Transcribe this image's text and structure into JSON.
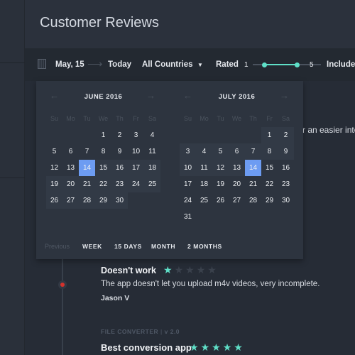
{
  "header": {
    "title": "Customer Reviews"
  },
  "filter": {
    "from": "May, 15",
    "to": "Today",
    "country": "All Countries",
    "rated_label": "Rated",
    "rating_min": "1",
    "rating_max": "5",
    "rating_range": [
      1,
      5
    ],
    "include": "Include"
  },
  "calendar": {
    "weekdays": [
      "Su",
      "Mo",
      "Tu",
      "We",
      "Th",
      "Fr",
      "Sa"
    ],
    "months": [
      {
        "title": "JUNE 2016",
        "first_weekday": 3,
        "days": 30,
        "selected": 14,
        "range_from": 14
      },
      {
        "title": "JULY 2016",
        "first_weekday": 5,
        "days": 31,
        "selected": 14,
        "range_to": 14
      }
    ],
    "footer": {
      "previous": "Previous",
      "week": "WEEK",
      "days15": "15 DAYS",
      "month": "MONTH",
      "months2": "2 MONTHS"
    }
  },
  "reviews": [
    {
      "partial_text": "r an easier inter"
    },
    {
      "title": "Doesn't work",
      "rating": 1,
      "text": "The app doesn't let you upload m4v videos, very incomplete.",
      "author": "Jason V"
    },
    {
      "app": "FILE CONVERTER",
      "version": "v 2.0",
      "title": "Best conversion app",
      "rating": 5
    }
  ],
  "colors": {
    "accent": "#5fe0c8",
    "selected": "#6d9cf2",
    "alert": "#d4322c"
  }
}
